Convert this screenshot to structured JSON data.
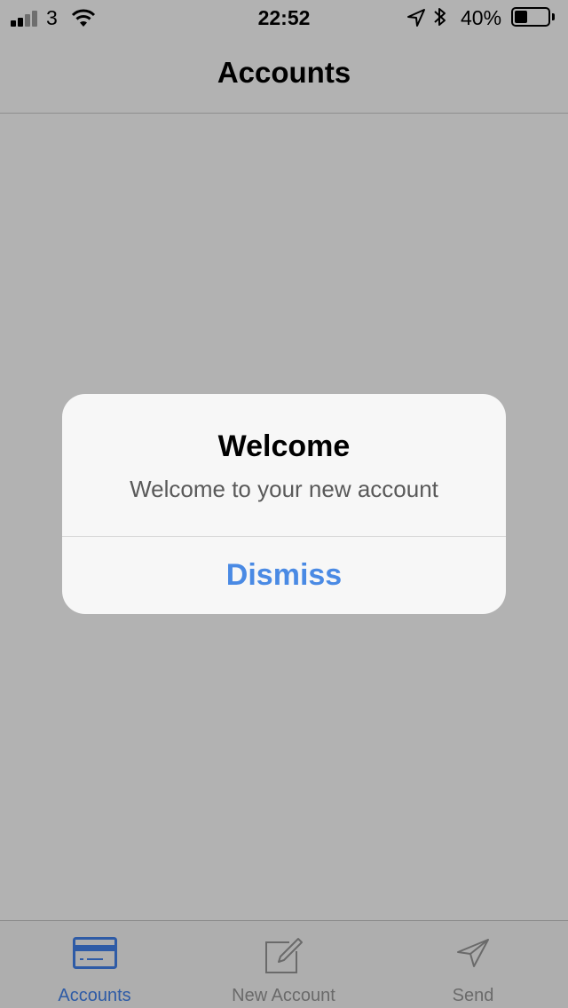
{
  "status_bar": {
    "carrier": "3",
    "time": "22:52",
    "battery_percent": "40%",
    "battery_level": 0.4,
    "signal_bars_active": 2,
    "signal_bars_total": 4,
    "icons": [
      "signal-icon",
      "wifi-icon",
      "location-arrow-icon",
      "bluetooth-icon",
      "battery-icon"
    ]
  },
  "nav": {
    "title": "Accounts"
  },
  "alert": {
    "title": "Welcome",
    "message": "Welcome to your new account",
    "button_label": "Dismiss"
  },
  "tab_bar": {
    "tabs": [
      {
        "label": "Accounts",
        "icon": "credit-card-icon",
        "active": true
      },
      {
        "label": "New Account",
        "icon": "compose-icon",
        "active": false
      },
      {
        "label": "Send",
        "icon": "paper-plane-icon",
        "active": false
      }
    ]
  },
  "colors": {
    "overlay_background": "#b2b2b2",
    "accent": "#4a8ae4",
    "active_tab": "#2e5ba6",
    "inactive_tab": "#6a6a6a"
  }
}
